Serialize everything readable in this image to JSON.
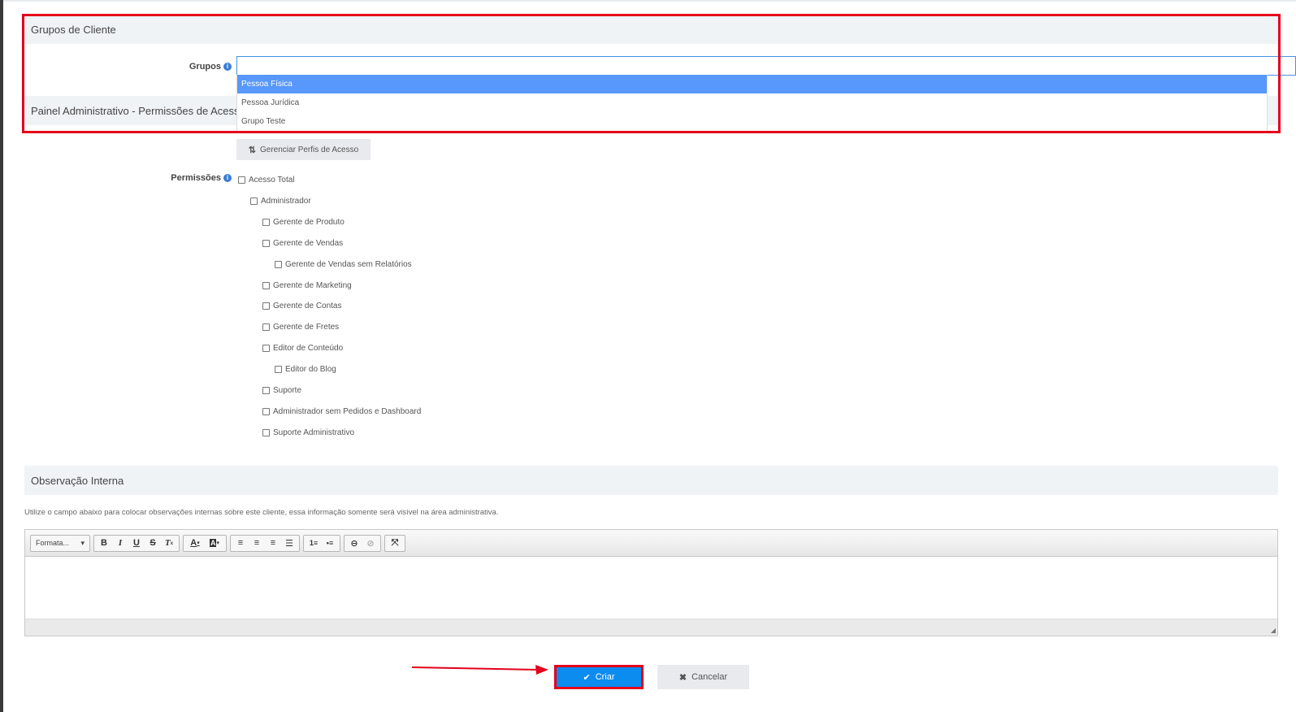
{
  "sections": {
    "client_groups": "Grupos de Cliente",
    "admin_panel": "Painel Administrativo - Permissões de Acesso",
    "internal_note": "Observação Interna"
  },
  "groups_field": {
    "label": "Grupos",
    "value": "",
    "options": [
      "Pessoa Física",
      "Pessoa Jurídica",
      "Grupo Teste"
    ],
    "highlighted": "Pessoa Física"
  },
  "manage_profiles_label": "Gerenciar Perfis de Acesso",
  "permissions": {
    "label": "Permissões",
    "items": [
      {
        "label": "Acesso Total",
        "level": 0
      },
      {
        "label": "Administrador",
        "level": 1
      },
      {
        "label": "Gerente de Produto",
        "level": 2
      },
      {
        "label": "Gerente de Vendas",
        "level": 2
      },
      {
        "label": "Gerente de Vendas sem Relatórios",
        "level": 3
      },
      {
        "label": "Gerente de Marketing",
        "level": 2
      },
      {
        "label": "Gerente de Contas",
        "level": 2
      },
      {
        "label": "Gerente de Fretes",
        "level": 2
      },
      {
        "label": "Editor de Conteúdo",
        "level": 2
      },
      {
        "label": "Editor do Blog",
        "level": 3
      },
      {
        "label": "Suporte",
        "level": 2
      },
      {
        "label": "Administrador sem Pedidos e Dashboard",
        "level": 2
      },
      {
        "label": "Suporte Administrativo",
        "level": 2
      }
    ]
  },
  "help_text": "Utilize o campo abaixo para colocar observações internas sobre este cliente, essa informação somente será visível na área administrativa.",
  "editor": {
    "format_label": "Formata...",
    "content": ""
  },
  "buttons": {
    "create": "Criar",
    "cancel": "Cancelar"
  },
  "colors": {
    "accent": "#0d8cf0",
    "highlight": "#5897fb",
    "annotation": "#e4001b"
  }
}
